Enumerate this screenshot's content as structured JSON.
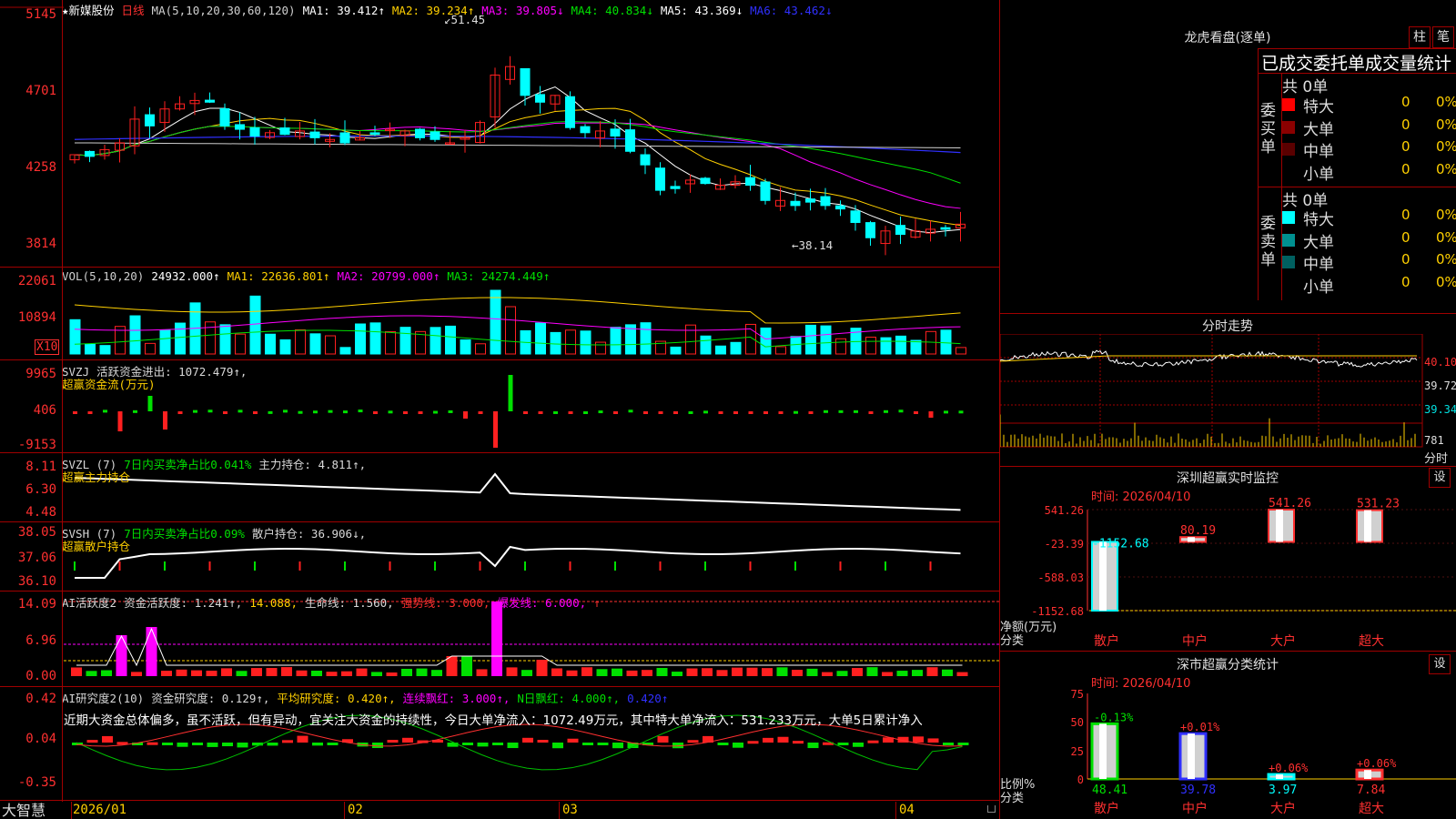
{
  "stock": {
    "name": "★新媒股份",
    "period": "日线"
  },
  "ma_bar": [
    {
      "text": "MA(5,10,20,30,60,120)",
      "color": "#d0d0d0"
    },
    {
      "text": "MA1: 39.412↑",
      "color": "#ffffff"
    },
    {
      "text": "MA2: 39.234↑",
      "color": "#ffd000"
    },
    {
      "text": "MA3: 39.805↓",
      "color": "#ff00ff"
    },
    {
      "text": "MA4: 40.834↓",
      "color": "#00e000"
    },
    {
      "text": "MA5: 43.369↓",
      "color": "#ffffff"
    },
    {
      "text": "MA6: 43.462↓",
      "color": "#3030ff"
    }
  ],
  "price_axis": [
    "5145",
    "4701",
    "4258",
    "3814"
  ],
  "price_marks": {
    "high": "51.45",
    "low": "38.14"
  },
  "vol_bar": [
    {
      "text": "VOL(5,10,20)",
      "color": "#d0d0d0"
    },
    {
      "text": "24932.000↑",
      "color": "#ffffff"
    },
    {
      "text": "MA1: 22636.801↑",
      "color": "#ffd000"
    },
    {
      "text": "MA2: 20799.000↑",
      "color": "#ff00ff"
    },
    {
      "text": "MA3: 24274.449↑",
      "color": "#00e000"
    }
  ],
  "vol_axis": [
    "22061",
    "10894"
  ],
  "vol_unit": "X10",
  "svzj": {
    "title": "SVZJ",
    "line": "活跃资金进出: 1072.479↑,",
    "sub": "超赢资金流(万元)",
    "axis": [
      "9965",
      "406",
      "-9153"
    ]
  },
  "svzl": {
    "line1": "SVZL (7)",
    "line2": "7日内买卖净占比0.041%",
    "line3": "主力持仓: 4.811↑,",
    "sub": "超赢主力持仓",
    "axis": [
      "8.11",
      "6.30",
      "4.48"
    ]
  },
  "svsh": {
    "line1": "SVSH (7)",
    "line2": "7日内买卖净占比0.09%",
    "line3": "散户持仓: 36.906↓,",
    "sub": "超赢散户持仓",
    "axis": [
      "38.05",
      "37.06",
      "36.10"
    ]
  },
  "ai1": {
    "items": [
      {
        "text": "AI活跃度2",
        "color": "#d8d8d8"
      },
      {
        "text": "资金活跃度: 1.241↑,",
        "color": "#d8d8d8"
      },
      {
        "text": "14.088,",
        "color": "#ffd000"
      },
      {
        "text": "生命线: 1.560,",
        "color": "#d8d8d8"
      },
      {
        "text": "强势线: 3.000,",
        "color": "#ff3030"
      },
      {
        "text": "爆发线: 6.000,",
        "color": "#ff00ff"
      },
      {
        "text": "↑",
        "color": "#ff3030"
      }
    ],
    "axis": [
      "14.09",
      "6.96",
      "0.00"
    ]
  },
  "ai2": {
    "items": [
      {
        "text": "AI研究度2(10)",
        "color": "#d8d8d8"
      },
      {
        "text": "资金研究度: 0.129↑,",
        "color": "#d8d8d8"
      },
      {
        "text": "平均研究度: 0.420↑,",
        "color": "#ffd000"
      },
      {
        "text": "连续飘红: 3.000↑,",
        "color": "#ff00ff"
      },
      {
        "text": "N日飘红: 4.000↑,",
        "color": "#00e000"
      },
      {
        "text": "0.420↑",
        "color": "#3030ff"
      }
    ],
    "comment": "近期大资金总体偏多，虽不活跃，但有异动，宜关注大资金的持续性，今日大单净流入：1072.49万元，其中特大单净流入：531.233万元，大单5日累计净入",
    "axis": [
      "0.42",
      "0.04",
      "-0.35"
    ]
  },
  "bottom_bar": {
    "brand": "大智慧",
    "dates": [
      "2026/01",
      "02",
      "03",
      "04"
    ]
  },
  "lhb": {
    "title": "龙虎看盘(逐单)",
    "btn1": "柱",
    "btn2": "笔",
    "header": "已成交委托单成交量统计",
    "buy": {
      "label": "委买单",
      "total": "共 0单",
      "rows": [
        {
          "name": "特大",
          "n": "0",
          "p": "0%",
          "color": "#ff0000"
        },
        {
          "name": "大单",
          "n": "0",
          "p": "0%",
          "color": "#8a0000"
        },
        {
          "name": "中单",
          "n": "0",
          "p": "0%",
          "color": "#5a0000"
        },
        {
          "name": "小单",
          "n": "0",
          "p": "0%",
          "color": "#000000"
        }
      ]
    },
    "sell": {
      "label": "委卖单",
      "total": "共 0单",
      "rows": [
        {
          "name": "特大",
          "n": "0",
          "p": "0%",
          "color": "#00ffff"
        },
        {
          "name": "大单",
          "n": "0",
          "p": "0%",
          "color": "#009090"
        },
        {
          "name": "中单",
          "n": "0",
          "p": "0%",
          "color": "#006060"
        },
        {
          "name": "小单",
          "n": "0",
          "p": "0%",
          "color": "#000000"
        }
      ]
    }
  },
  "fenshi": {
    "title": "分时走势",
    "axis": [
      "40.10",
      "39.72",
      "39.34"
    ],
    "vol_top": "781",
    "vol_bottom": "分时"
  },
  "monitor": {
    "title": "深圳超赢实时监控",
    "set": "设",
    "time": "时间: 2026/04/10",
    "axis": [
      "541.26",
      "-23.39",
      "-588.03",
      "-1152.68"
    ],
    "ylabel1": "净额(万元)",
    "ylabel2": "分类",
    "bars": [
      {
        "cat": "散户",
        "value": -1152.68,
        "label": "-1152.68"
      },
      {
        "cat": "中户",
        "value": 80.19,
        "label": "80.19"
      },
      {
        "cat": "大户",
        "value": 541.26,
        "label": "541.26"
      },
      {
        "cat": "超大",
        "value": 531.23,
        "label": "531.23"
      }
    ]
  },
  "classify": {
    "title": "深市超赢分类统计",
    "set": "设",
    "time": "时间: 2026/04/10",
    "axis": [
      "75",
      "50",
      "25",
      "0"
    ],
    "ylabel1": "比例%",
    "ylabel2": "分类",
    "bars": [
      {
        "cat": "散户",
        "value": 48.41,
        "label": "48.41",
        "delta": "-0.13%"
      },
      {
        "cat": "中户",
        "value": 39.78,
        "label": "39.78",
        "delta": "+0.01%"
      },
      {
        "cat": "大户",
        "value": 3.97,
        "label": "3.97",
        "delta": "+0.06%"
      },
      {
        "cat": "超大",
        "value": 7.84,
        "label": "7.84",
        "delta": "+0.06%"
      }
    ]
  }
}
